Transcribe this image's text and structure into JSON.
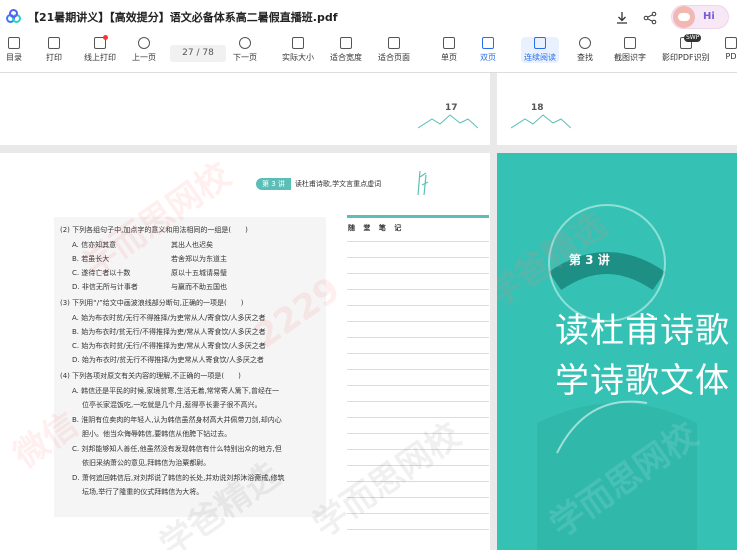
{
  "window": {
    "title": "【21暑期讲义】【高效提分】语文必备体系高二暑假直播班.pdf",
    "greeting": "Hi",
    "swp_badge": "SWP"
  },
  "toolbar": {
    "items": [
      {
        "label": "目录",
        "icon": "toc-icon"
      },
      {
        "label": "打印",
        "icon": "printer-icon"
      },
      {
        "label": "线上打印",
        "icon": "online-print-icon"
      },
      {
        "label": "上一页",
        "icon": "prev-page-icon"
      },
      {
        "label": "下一页",
        "icon": "next-page-icon"
      },
      {
        "label": "实际大小",
        "icon": "actual-size-icon"
      },
      {
        "label": "适合宽度",
        "icon": "fit-width-icon"
      },
      {
        "label": "适合页面",
        "icon": "fit-page-icon"
      },
      {
        "label": "单页",
        "icon": "single-page-icon"
      },
      {
        "label": "双页",
        "icon": "double-page-icon"
      },
      {
        "label": "连续阅读",
        "icon": "continuous-read-icon"
      },
      {
        "label": "查找",
        "icon": "search-icon"
      },
      {
        "label": "截图识字",
        "icon": "screenshot-ocr-icon"
      },
      {
        "label": "影印PDF识别",
        "icon": "pdf-recognize-icon"
      },
      {
        "label": "PD",
        "icon": "pdf-more-icon"
      }
    ],
    "page_indicator": "27 / 78",
    "active": "双页"
  },
  "pages": {
    "top_left_num": "17",
    "top_right_num": "18"
  },
  "lesson": {
    "badge": "第 3 讲",
    "title": "读杜甫诗歌,学文言重点虚词"
  },
  "questions": {
    "q2": "(2) 下列各组句子中,加点字的意义和用法相同的一组是(　　)",
    "q2_opts": [
      {
        "a": "A. 信亦知其意",
        "b": "其出人也迟矣"
      },
      {
        "a": "B. 若虽长大",
        "b": "若舍郑以为东道主"
      },
      {
        "a": "C. 遂待亡者以十数",
        "b": "原以十五城请易璧"
      },
      {
        "a": "D. 非信无所与计事者",
        "b": "与嬴而不助五国也"
      }
    ],
    "q3": "(3) 下列用“/”给文中画波浪线部分断句,正确的一项是(　　)",
    "q3_opts": [
      "A. 始为布衣时贫/无行不得推择/为吏常从人/寄食饮/人多厌之者",
      "B. 始为布衣时/贫无行/不得推择为吏/常从人寄食饮/人多厌之者",
      "C. 始为布衣时贫/无行/不得推择为吏/常从人寄食饮/人多厌之者",
      "D. 始为布衣时/贫无行不得推择/为吏常从人寄食饮/人多厌之者"
    ],
    "q4": "(4) 下列各项对原文有关内容的理解,不正确的一项是(　　)",
    "q4_opts": [
      [
        "A. 韩信还是平民的时候,家境贫寒,生活无着,常常寄人篱下,曾经在一",
        "位亭长家混饭吃,一吃就是几个月,惹得亭长妻子很不高兴。"
      ],
      [
        "B. 淮阴有位卖肉的年轻人,认为韩信虽然身材高大并佩带刀剑,却内心",
        "胆小。他当众侮辱韩信,要韩信从他胯下钻过去。"
      ],
      [
        "C. 刘邦能够知人善任,他虽然没有发现韩信有什么特别出众的地方,但",
        "依旧采纳萧公的意见,拜韩信为治粟都尉。"
      ],
      [
        "D. 萧何追回韩信后,对刘邦说了韩信的长处,并劝说刘邦沐浴斋戒,修筑",
        "坛场,举行了隆重的仪式拜韩信为大将。"
      ]
    ]
  },
  "notes": {
    "title": "随 堂 笔 记"
  },
  "cover": {
    "lesson_badge": "第 3 讲",
    "line1": "读杜甫诗歌",
    "line2": "学诗歌文体"
  },
  "watermarks": [
    "学而思网校",
    "微信 ",
    "学爸精选",
    "2229"
  ],
  "colors": {
    "accent": "#2a6ef0",
    "teal": "#35c2b5"
  }
}
